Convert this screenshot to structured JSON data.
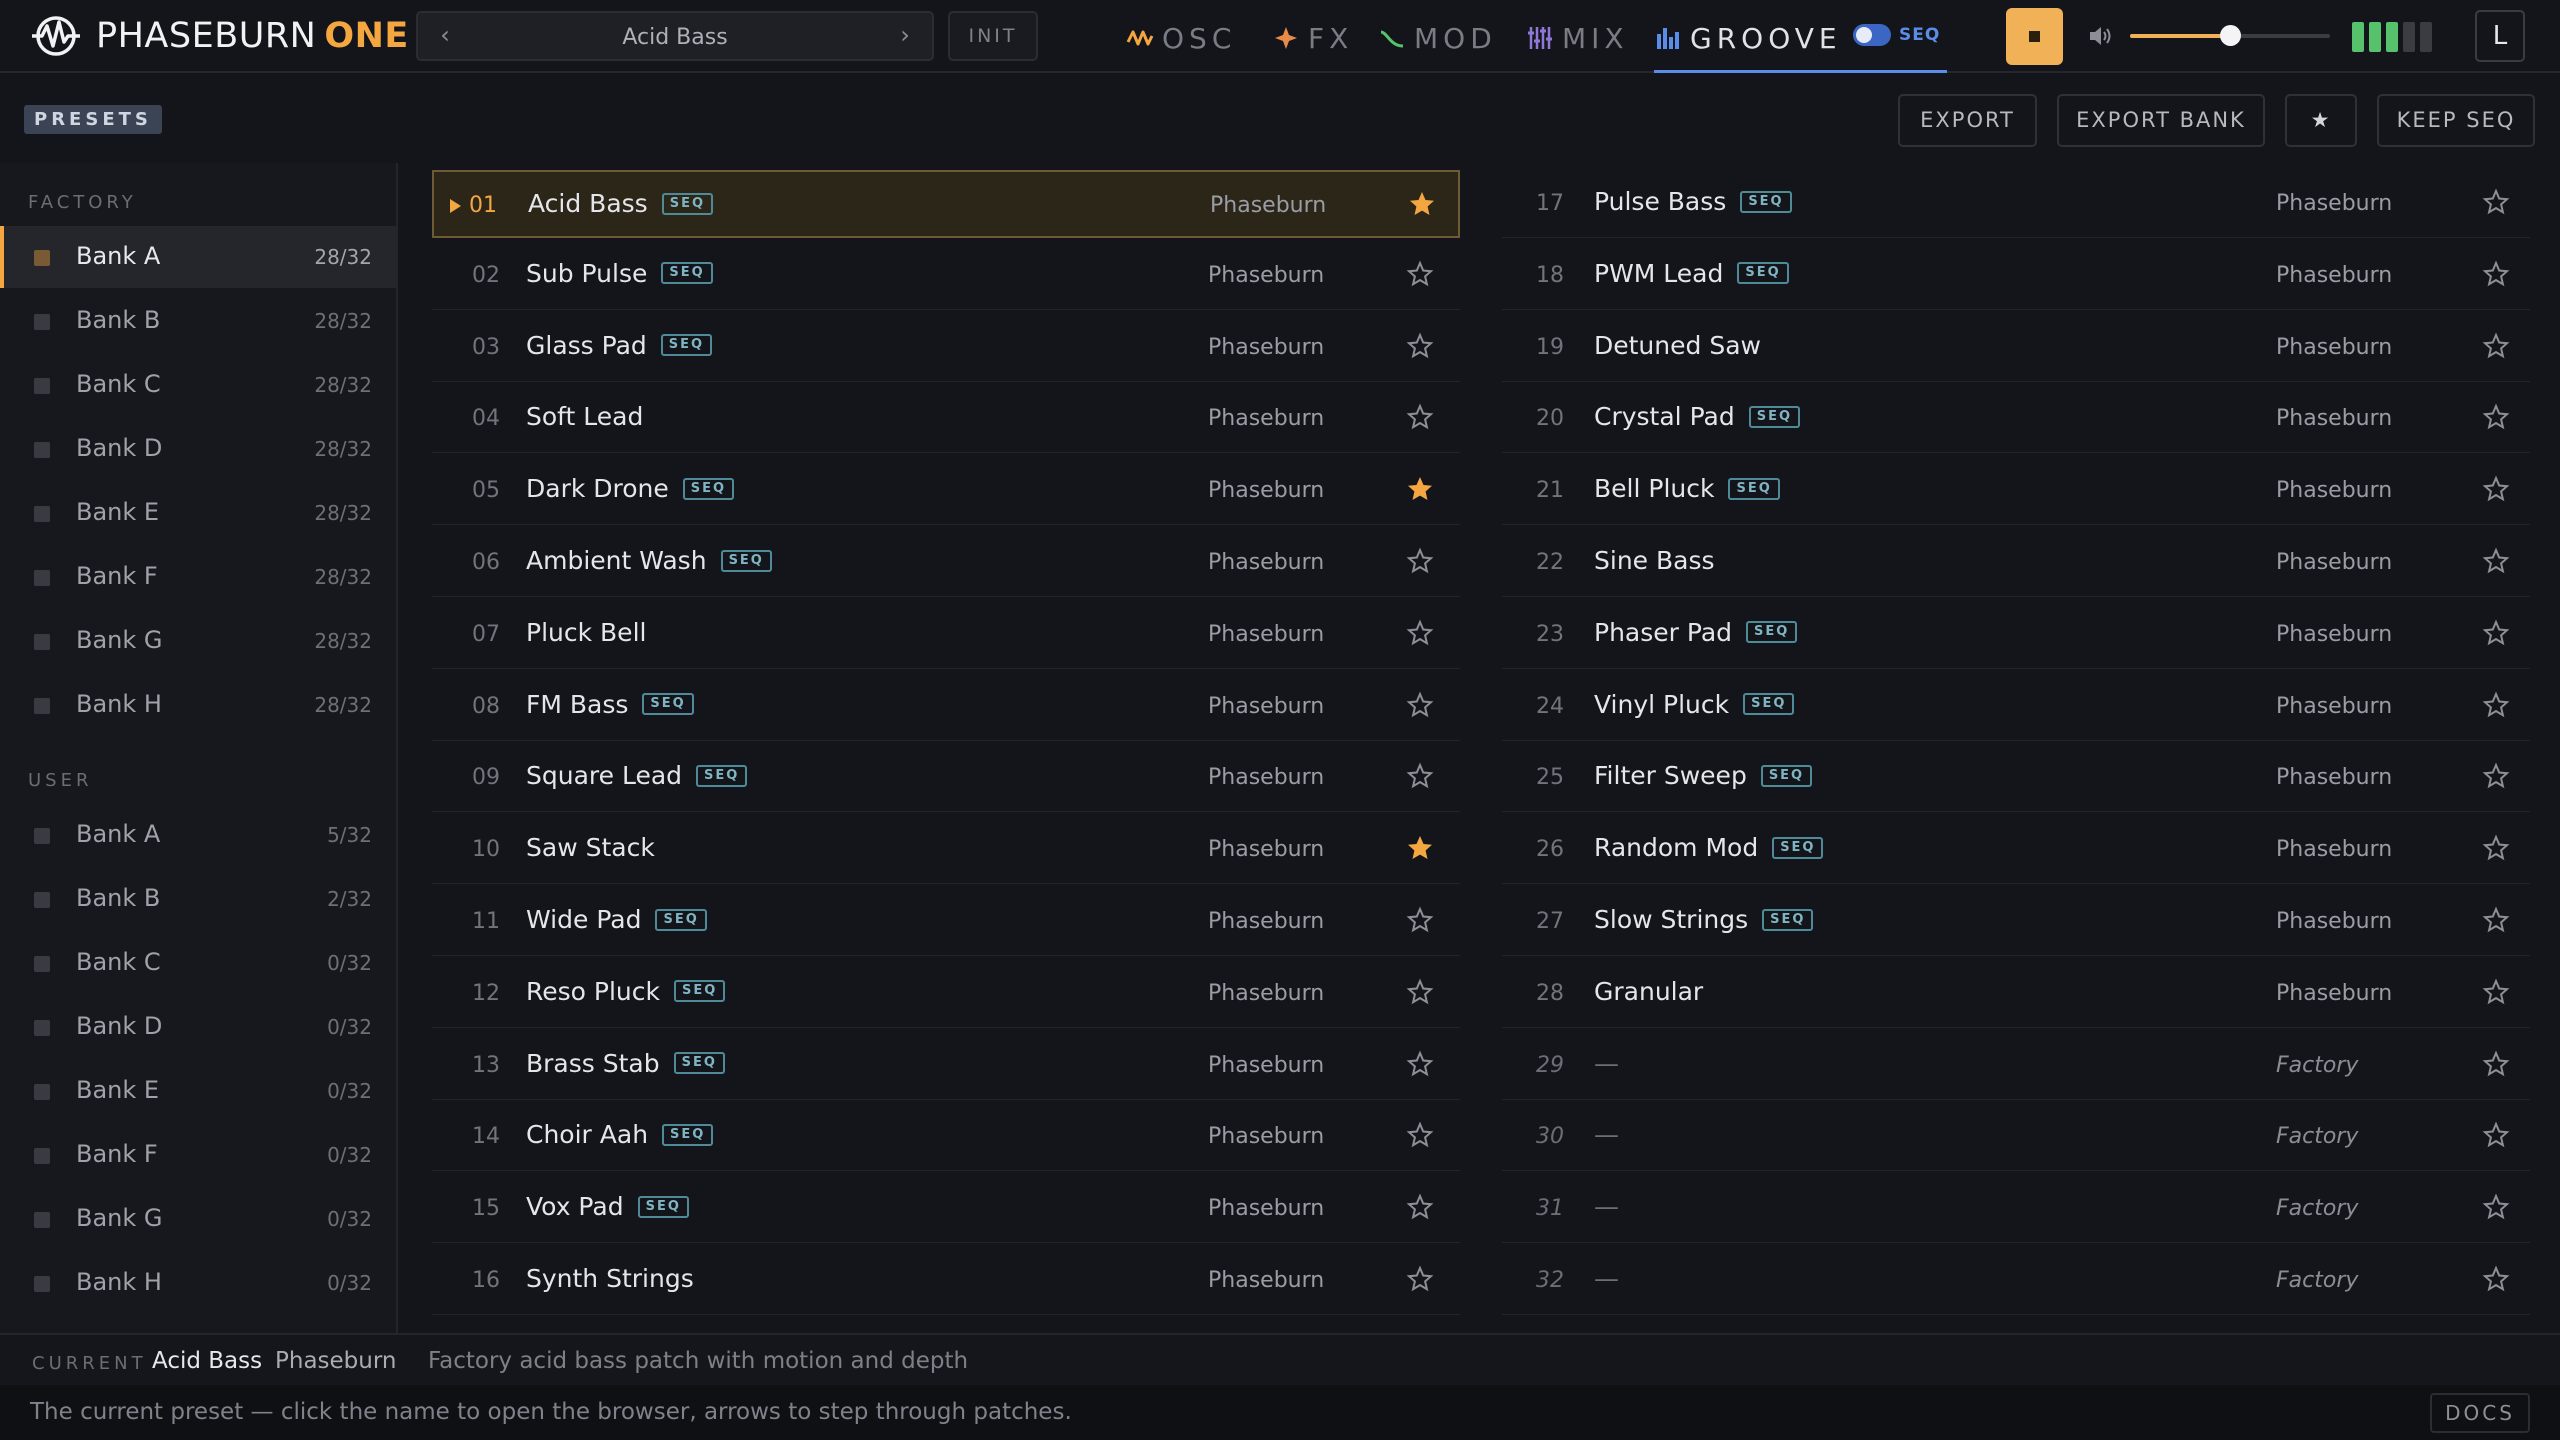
{
  "app": {
    "name": "PHASEBURN",
    "edition": "ONE"
  },
  "preset_selector": {
    "current": "Acid Bass",
    "prev": "‹",
    "next": "›",
    "init_label": "INIT"
  },
  "tabs": [
    {
      "label": "OSC",
      "icon": "wave-icon"
    },
    {
      "label": "FX",
      "icon": "sparkle-icon"
    },
    {
      "label": "MOD",
      "icon": "curve-icon"
    },
    {
      "label": "MIX",
      "icon": "faders-icon"
    },
    {
      "label": "GROOVE",
      "icon": "bars-icon",
      "active": true
    }
  ],
  "seq_toggle": {
    "label": "SEQ",
    "on": true
  },
  "volume": {
    "level": 0.5
  },
  "meter": {
    "lit": 3,
    "total": 5
  },
  "lock_label": "L",
  "toolbar": {
    "presets_label": "PRESETS",
    "export": "EXPORT",
    "export_bank": "EXPORT BANK",
    "favorite": "★",
    "keep_seq": "KEEP SEQ"
  },
  "sidebar": {
    "factory_label": "FACTORY",
    "user_label": "USER",
    "factory_banks": [
      {
        "name": "Bank A",
        "count": "28/32",
        "active": true
      },
      {
        "name": "Bank B",
        "count": "28/32"
      },
      {
        "name": "Bank C",
        "count": "28/32"
      },
      {
        "name": "Bank D",
        "count": "28/32"
      },
      {
        "name": "Bank E",
        "count": "28/32"
      },
      {
        "name": "Bank F",
        "count": "28/32"
      },
      {
        "name": "Bank G",
        "count": "28/32"
      },
      {
        "name": "Bank H",
        "count": "28/32"
      }
    ],
    "user_banks": [
      {
        "name": "Bank A",
        "count": "5/32"
      },
      {
        "name": "Bank B",
        "count": "2/32"
      },
      {
        "name": "Bank C",
        "count": "0/32"
      },
      {
        "name": "Bank D",
        "count": "0/32"
      },
      {
        "name": "Bank E",
        "count": "0/32"
      },
      {
        "name": "Bank F",
        "count": "0/32"
      },
      {
        "name": "Bank G",
        "count": "0/32"
      },
      {
        "name": "Bank H",
        "count": "0/32"
      }
    ]
  },
  "seq_tag": "SEQ",
  "presets": [
    {
      "num": "01",
      "name": "Acid Bass",
      "seq": true,
      "author": "Phaseburn",
      "fav": true,
      "selected": true
    },
    {
      "num": "02",
      "name": "Sub Pulse",
      "seq": true,
      "author": "Phaseburn",
      "fav": false
    },
    {
      "num": "03",
      "name": "Glass Pad",
      "seq": true,
      "author": "Phaseburn",
      "fav": false
    },
    {
      "num": "04",
      "name": "Soft Lead",
      "seq": false,
      "author": "Phaseburn",
      "fav": false
    },
    {
      "num": "05",
      "name": "Dark Drone",
      "seq": true,
      "author": "Phaseburn",
      "fav": true
    },
    {
      "num": "06",
      "name": "Ambient Wash",
      "seq": true,
      "author": "Phaseburn",
      "fav": false
    },
    {
      "num": "07",
      "name": "Pluck Bell",
      "seq": false,
      "author": "Phaseburn",
      "fav": false
    },
    {
      "num": "08",
      "name": "FM Bass",
      "seq": true,
      "author": "Phaseburn",
      "fav": false
    },
    {
      "num": "09",
      "name": "Square Lead",
      "seq": true,
      "author": "Phaseburn",
      "fav": false
    },
    {
      "num": "10",
      "name": "Saw Stack",
      "seq": false,
      "author": "Phaseburn",
      "fav": true
    },
    {
      "num": "11",
      "name": "Wide Pad",
      "seq": true,
      "author": "Phaseburn",
      "fav": false
    },
    {
      "num": "12",
      "name": "Reso Pluck",
      "seq": true,
      "author": "Phaseburn",
      "fav": false
    },
    {
      "num": "13",
      "name": "Brass Stab",
      "seq": true,
      "author": "Phaseburn",
      "fav": false
    },
    {
      "num": "14",
      "name": "Choir Aah",
      "seq": true,
      "author": "Phaseburn",
      "fav": false
    },
    {
      "num": "15",
      "name": "Vox Pad",
      "seq": true,
      "author": "Phaseburn",
      "fav": false
    },
    {
      "num": "16",
      "name": "Synth Strings",
      "seq": false,
      "author": "Phaseburn",
      "fav": false
    },
    {
      "num": "17",
      "name": "Pulse Bass",
      "seq": true,
      "author": "Phaseburn",
      "fav": false
    },
    {
      "num": "18",
      "name": "PWM Lead",
      "seq": true,
      "author": "Phaseburn",
      "fav": false
    },
    {
      "num": "19",
      "name": "Detuned Saw",
      "seq": false,
      "author": "Phaseburn",
      "fav": false
    },
    {
      "num": "20",
      "name": "Crystal Pad",
      "seq": true,
      "author": "Phaseburn",
      "fav": false
    },
    {
      "num": "21",
      "name": "Bell Pluck",
      "seq": true,
      "author": "Phaseburn",
      "fav": false
    },
    {
      "num": "22",
      "name": "Sine Bass",
      "seq": false,
      "author": "Phaseburn",
      "fav": false
    },
    {
      "num": "23",
      "name": "Phaser Pad",
      "seq": true,
      "author": "Phaseburn",
      "fav": false
    },
    {
      "num": "24",
      "name": "Vinyl Pluck",
      "seq": true,
      "author": "Phaseburn",
      "fav": false
    },
    {
      "num": "25",
      "name": "Filter Sweep",
      "seq": true,
      "author": "Phaseburn",
      "fav": false
    },
    {
      "num": "26",
      "name": "Random Mod",
      "seq": true,
      "author": "Phaseburn",
      "fav": false
    },
    {
      "num": "27",
      "name": "Slow Strings",
      "seq": true,
      "author": "Phaseburn",
      "fav": false
    },
    {
      "num": "28",
      "name": "Granular",
      "seq": false,
      "author": "Phaseburn",
      "fav": false
    },
    {
      "num": "29",
      "name": "—",
      "seq": false,
      "author": "Factory",
      "fav": false,
      "empty": true
    },
    {
      "num": "30",
      "name": "—",
      "seq": false,
      "author": "Factory",
      "fav": false,
      "empty": true
    },
    {
      "num": "31",
      "name": "—",
      "seq": false,
      "author": "Factory",
      "fav": false,
      "empty": true
    },
    {
      "num": "32",
      "name": "—",
      "seq": false,
      "author": "Factory",
      "fav": false,
      "empty": true
    }
  ],
  "current": {
    "label": "CURRENT",
    "name": "Acid Bass",
    "author": "Phaseburn",
    "description": "Factory acid bass patch with motion and depth"
  },
  "status": {
    "hint": "The current preset — click the name to open the browser, arrows to step through patches.",
    "docs": "DOCS"
  },
  "colors": {
    "accent": "#f4a640",
    "blue": "#5a8de8",
    "seq_tag": "#7fb5c3",
    "meter_on": "#57c26c"
  }
}
